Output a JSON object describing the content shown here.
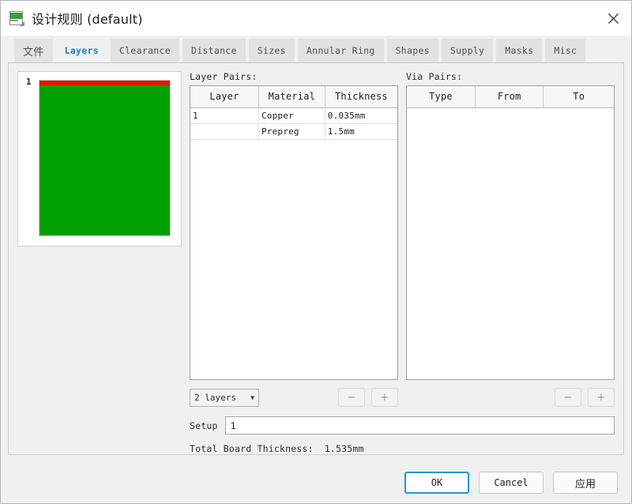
{
  "window": {
    "title": "设计规则 (default)",
    "icon": "design-rules-icon",
    "close_icon": "close-icon"
  },
  "tabs": [
    {
      "label": "文件",
      "active": false,
      "cjk": true
    },
    {
      "label": "Layers",
      "active": true,
      "cjk": false
    },
    {
      "label": "Clearance",
      "active": false,
      "cjk": false
    },
    {
      "label": "Distance",
      "active": false,
      "cjk": false
    },
    {
      "label": "Sizes",
      "active": false,
      "cjk": false
    },
    {
      "label": "Annular Ring",
      "active": false,
      "cjk": false
    },
    {
      "label": "Shapes",
      "active": false,
      "cjk": false
    },
    {
      "label": "Supply",
      "active": false,
      "cjk": false
    },
    {
      "label": "Masks",
      "active": false,
      "cjk": false
    },
    {
      "label": "Misc",
      "active": false,
      "cjk": false
    }
  ],
  "preview": {
    "index_label": "1",
    "copper_color": "#d91a00",
    "prepreg_color": "#00a000"
  },
  "layer_pairs": {
    "label": "Layer Pairs:",
    "columns": [
      "Layer",
      "Material",
      "Thickness"
    ],
    "rows": [
      [
        "1",
        "Copper",
        "0.035mm"
      ],
      [
        "",
        "Prepreg",
        "1.5mm"
      ]
    ],
    "layer_count_value": "2 layers",
    "remove_label": "−",
    "add_label": "+"
  },
  "via_pairs": {
    "label": "Via Pairs:",
    "columns": [
      "Type",
      "From",
      "To"
    ],
    "rows": [],
    "remove_label": "−",
    "add_label": "+"
  },
  "setup": {
    "label": "Setup",
    "value": "1",
    "placeholder": ""
  },
  "total": {
    "label": "Total Board Thickness:",
    "value": "1.535mm"
  },
  "footer": {
    "ok": "OK",
    "cancel": "Cancel",
    "apply": "应用"
  },
  "colors": {
    "accent": "#2196d6",
    "window_bg": "#f0f0f0",
    "panel_border": "#cdcdcd"
  }
}
